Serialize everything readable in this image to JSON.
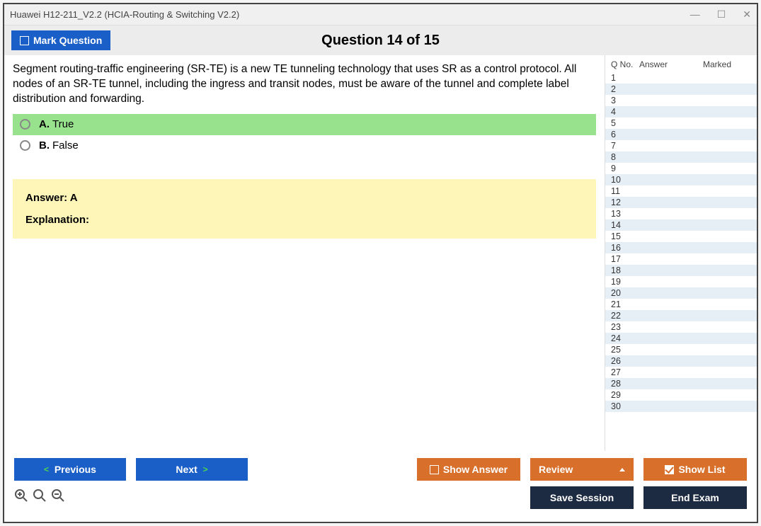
{
  "title": "Huawei H12-211_V2.2 (HCIA-Routing & Switching V2.2)",
  "markQuestion": "Mark Question",
  "questionHeader": "Question 14 of 15",
  "questionText": "Segment routing-traffic engineering (SR-TE) is a new TE tunneling technology that uses SR as a control protocol. All nodes of an SR-TE tunnel, including the ingress and transit nodes, must be aware of the tunnel and complete label distribution and forwarding.",
  "choices": [
    {
      "letter": "A.",
      "text": "True",
      "selected": true
    },
    {
      "letter": "B.",
      "text": "False",
      "selected": false
    }
  ],
  "answerLabel": "Answer: A",
  "explanationLabel": "Explanation:",
  "sideHeaders": {
    "qno": "Q No.",
    "answer": "Answer",
    "marked": "Marked"
  },
  "rowCount": 30,
  "buttons": {
    "previous": "Previous",
    "next": "Next",
    "showAnswer": "Show Answer",
    "review": "Review",
    "showList": "Show List",
    "saveSession": "Save Session",
    "endExam": "End Exam"
  }
}
